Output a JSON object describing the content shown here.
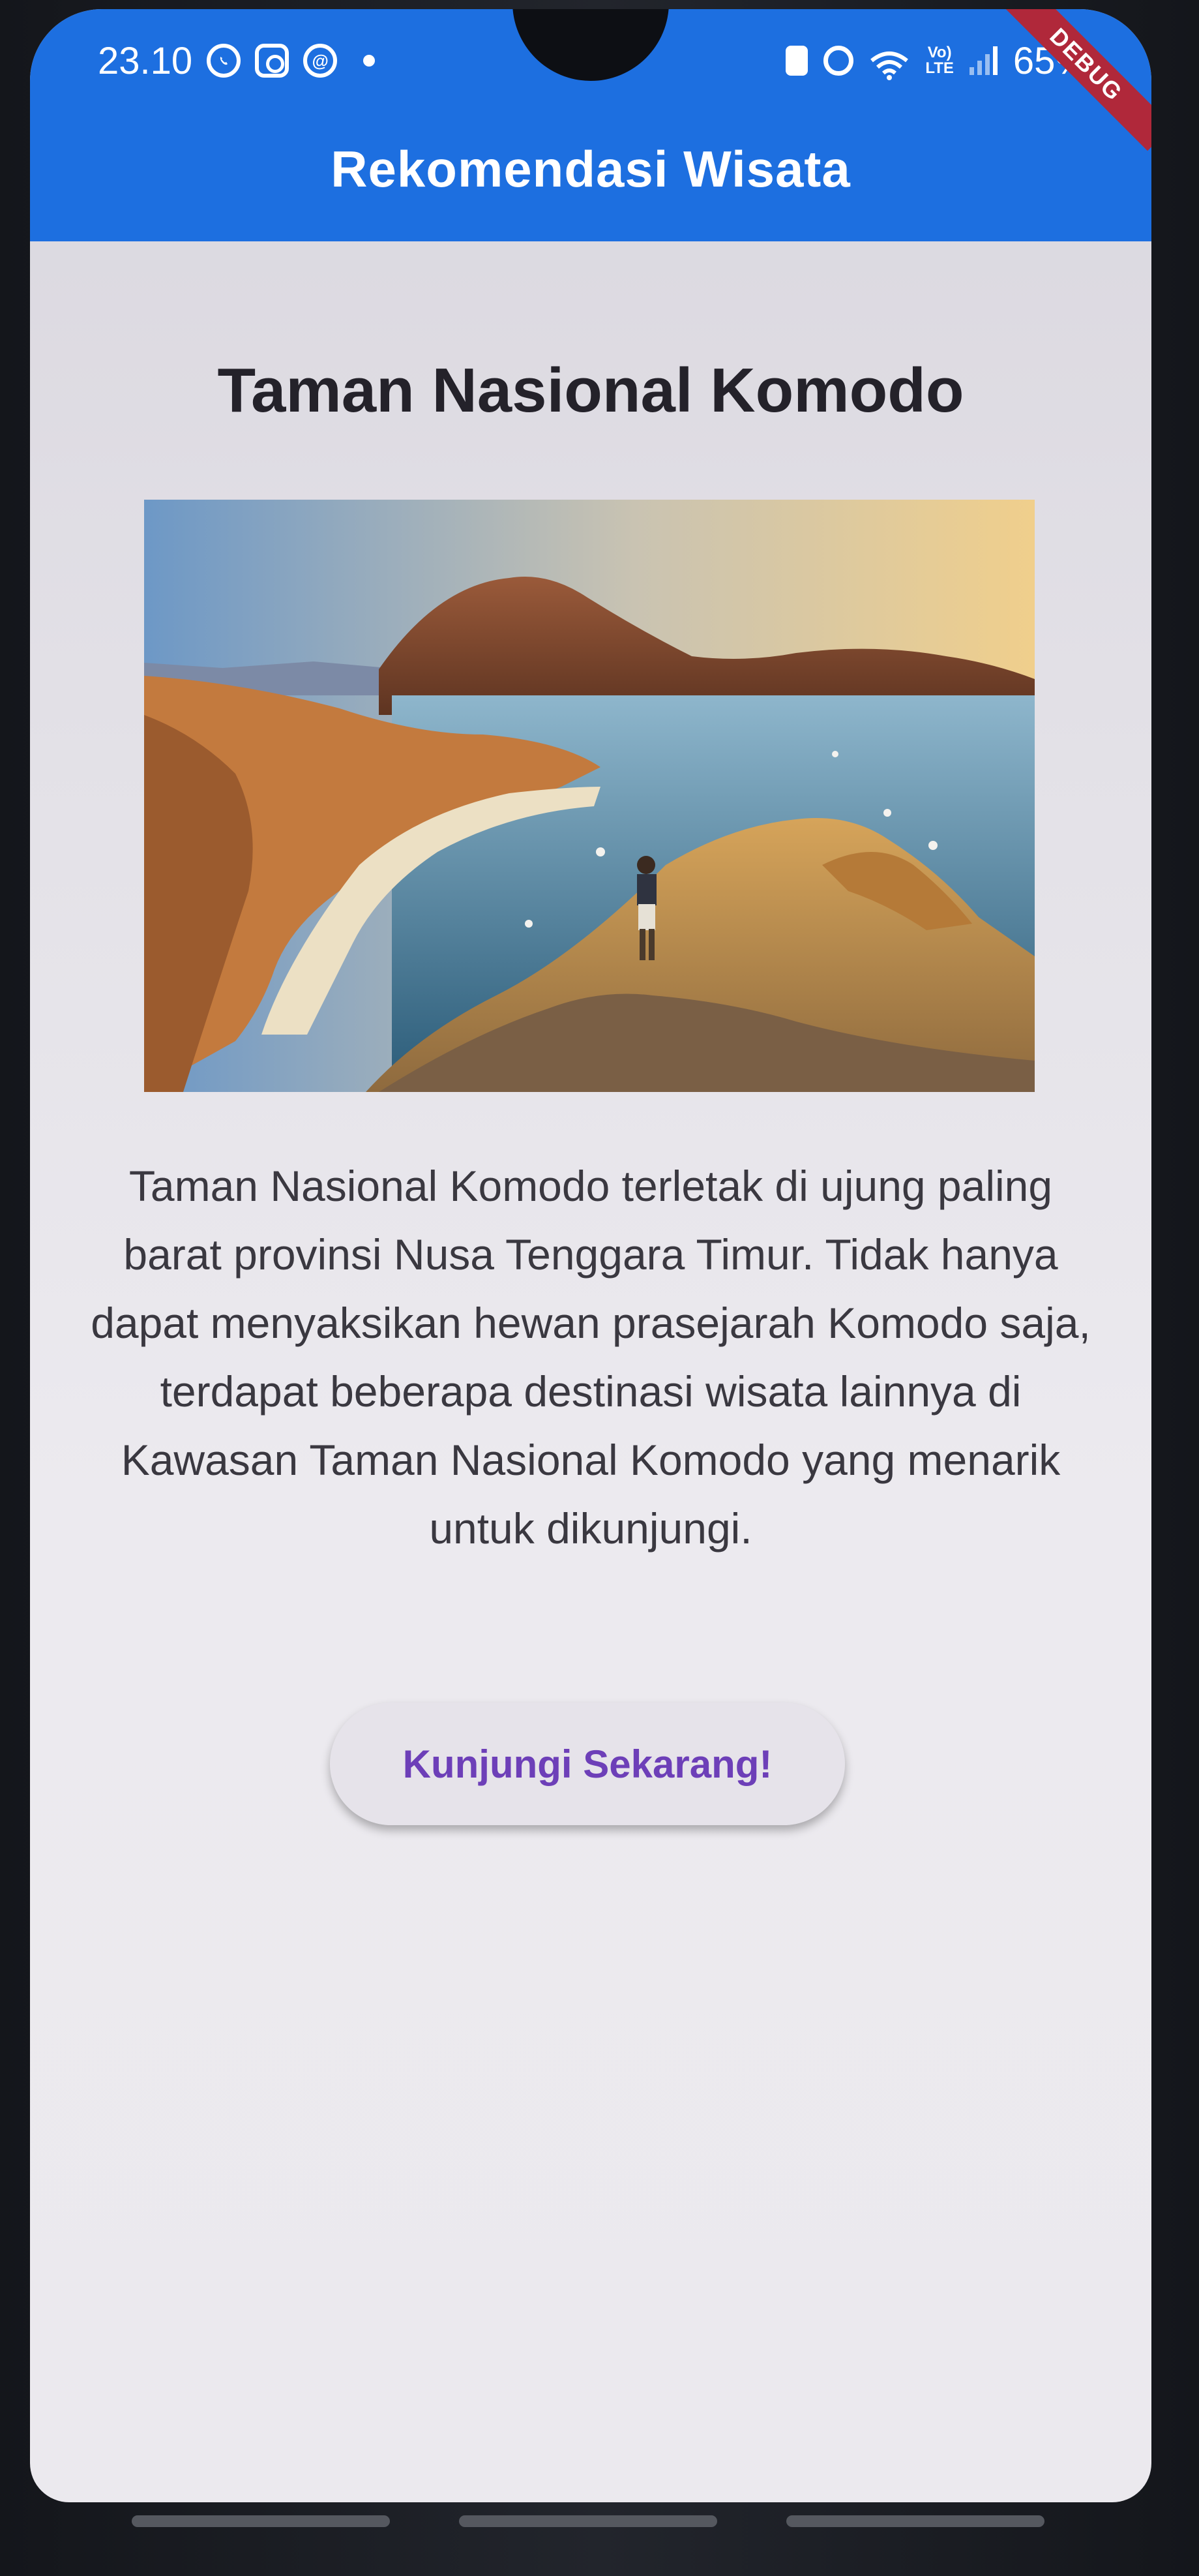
{
  "status_bar": {
    "time": "23.10",
    "battery": "65%",
    "network": "LTE"
  },
  "debug_banner": "DEBUG",
  "app_bar": {
    "title": "Rekomendasi Wisata"
  },
  "content": {
    "title": "Taman Nasional Komodo",
    "image_alt": "Taman Nasional Komodo",
    "description": "Taman Nasional Komodo terletak di ujung paling barat provinsi Nusa Tenggara Timur. Tidak hanya dapat menyaksikan hewan prasejarah Komodo saja, terdapat beberapa destinasi wisata lainnya di Kawasan Taman Nasional Komodo yang menarik untuk dikunjungi.",
    "button_label": "Kunjungi Sekarang!"
  },
  "colors": {
    "app_bar": "#1d6fe0",
    "button_text": "#6d3fb8",
    "title_text": "#24222a"
  }
}
